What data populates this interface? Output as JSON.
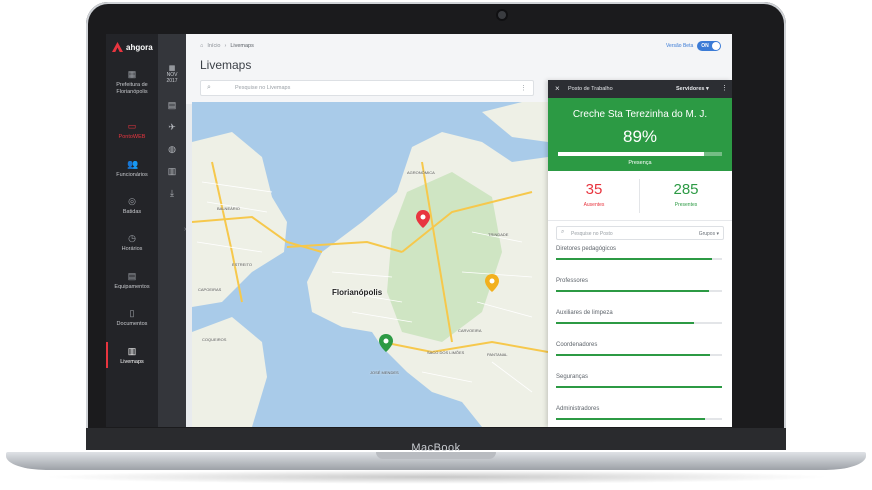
{
  "device": {
    "brand": "MacBook"
  },
  "sidebar": {
    "logo": "ahgora",
    "items": [
      {
        "label": "Prefeitura de Florianópolis",
        "icon": "building-icon"
      },
      {
        "label": "PontoWEB",
        "icon": "monitor-icon"
      },
      {
        "label": "Funcionários",
        "icon": "users-icon"
      },
      {
        "label": "Batidas",
        "icon": "fingerprint-icon"
      },
      {
        "label": "Horários",
        "icon": "clock-icon"
      },
      {
        "label": "Equipamentos",
        "icon": "device-icon"
      },
      {
        "label": "Documentos",
        "icon": "document-icon"
      },
      {
        "label": "Livemaps",
        "icon": "map-icon"
      }
    ]
  },
  "rail": {
    "month": "NOV",
    "year": "2017"
  },
  "header": {
    "breadcrumb": {
      "home": "Início",
      "separator": "›",
      "current": "Livemaps"
    },
    "title": "Livemaps",
    "search_placeholder": "Pesquise no Livemaps",
    "beta_label": "Versão Beta",
    "toggle_label": "ON"
  },
  "map": {
    "city_label": "Florianópolis",
    "labels": [
      "AGRONÔMICA",
      "TRINDADE",
      "CARVOEIRA",
      "PANTANAL",
      "SACO DOS LIMÕES",
      "JOSÉ MENDES",
      "BALNEÁRIO",
      "ESTREITO",
      "CAPOEIRAS",
      "COQUEIROS"
    ],
    "pins": [
      {
        "color": "#e8353f"
      },
      {
        "color": "#f2b01e"
      },
      {
        "color": "#2c9a44"
      }
    ]
  },
  "panel": {
    "title": "Posto de Trabalho",
    "filter_label": "Servidores",
    "place": "Creche Sta Terezinha do M. J.",
    "percent": "89%",
    "percent_value": 0.89,
    "presence_label": "Presença",
    "absent": {
      "value": "35",
      "label": "Ausentes"
    },
    "present": {
      "value": "285",
      "label": "Presentes"
    },
    "group_search_placeholder": "Pesquise no Posto",
    "group_select": "Grupos",
    "groups": [
      {
        "name": "Diretores pedagógicos",
        "fill": 0.94
      },
      {
        "name": "Professores",
        "fill": 0.92
      },
      {
        "name": "Auxiliares de limpeza",
        "fill": 0.83
      },
      {
        "name": "Coordenadores",
        "fill": 0.93
      },
      {
        "name": "Seguranças",
        "fill": 1.0
      },
      {
        "name": "Administradores",
        "fill": 0.9
      }
    ]
  }
}
